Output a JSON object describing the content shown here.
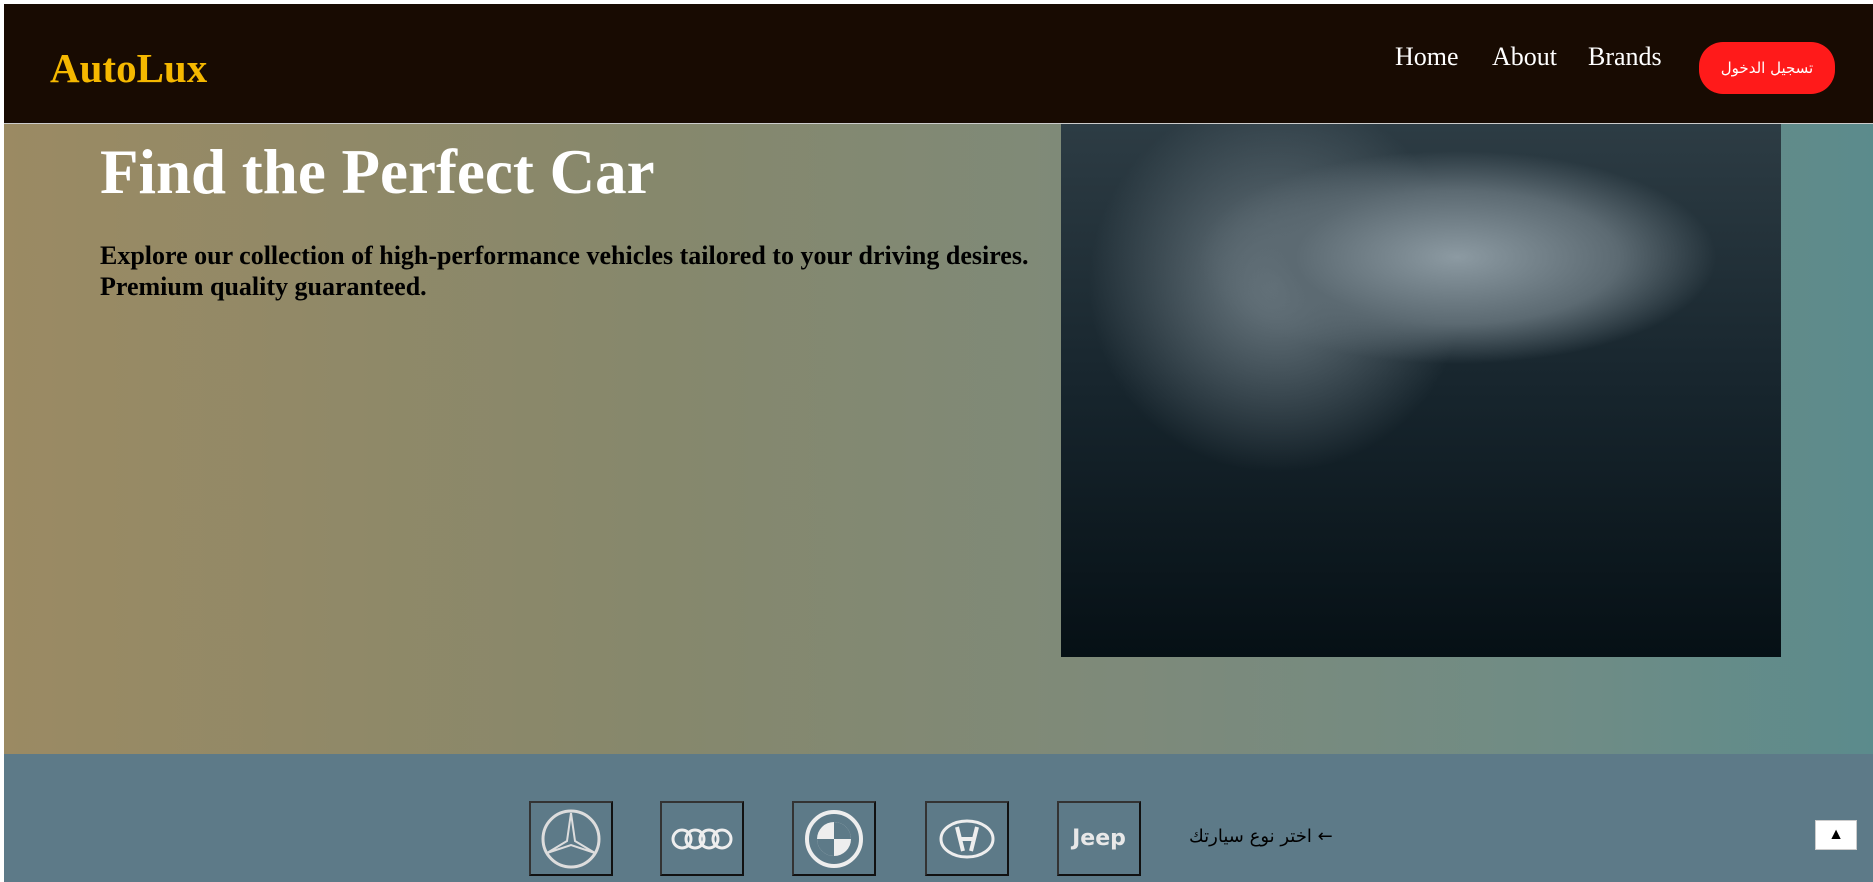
{
  "header": {
    "logo": "AutoLux",
    "nav": [
      "Home",
      "About",
      "Brands"
    ],
    "login": "تسجيل الدخول"
  },
  "hero": {
    "title": "Find the Perfect Car",
    "description": "Explore our collection of high-performance vehicles tailored to your driving desires. Premium quality guaranteed."
  },
  "brands": {
    "items": [
      "Mercedes",
      "Audi",
      "BMW",
      "Hyundai",
      "Jeep"
    ],
    "jeep_label": "Jeep",
    "choose": "اختر نوع سيارتك ←",
    "scroll_top": "▲"
  },
  "colors": {
    "header": "#180b02",
    "logo": "#f5b800",
    "login": "#ff1a1a",
    "brands_bg": "#5d7a88"
  }
}
